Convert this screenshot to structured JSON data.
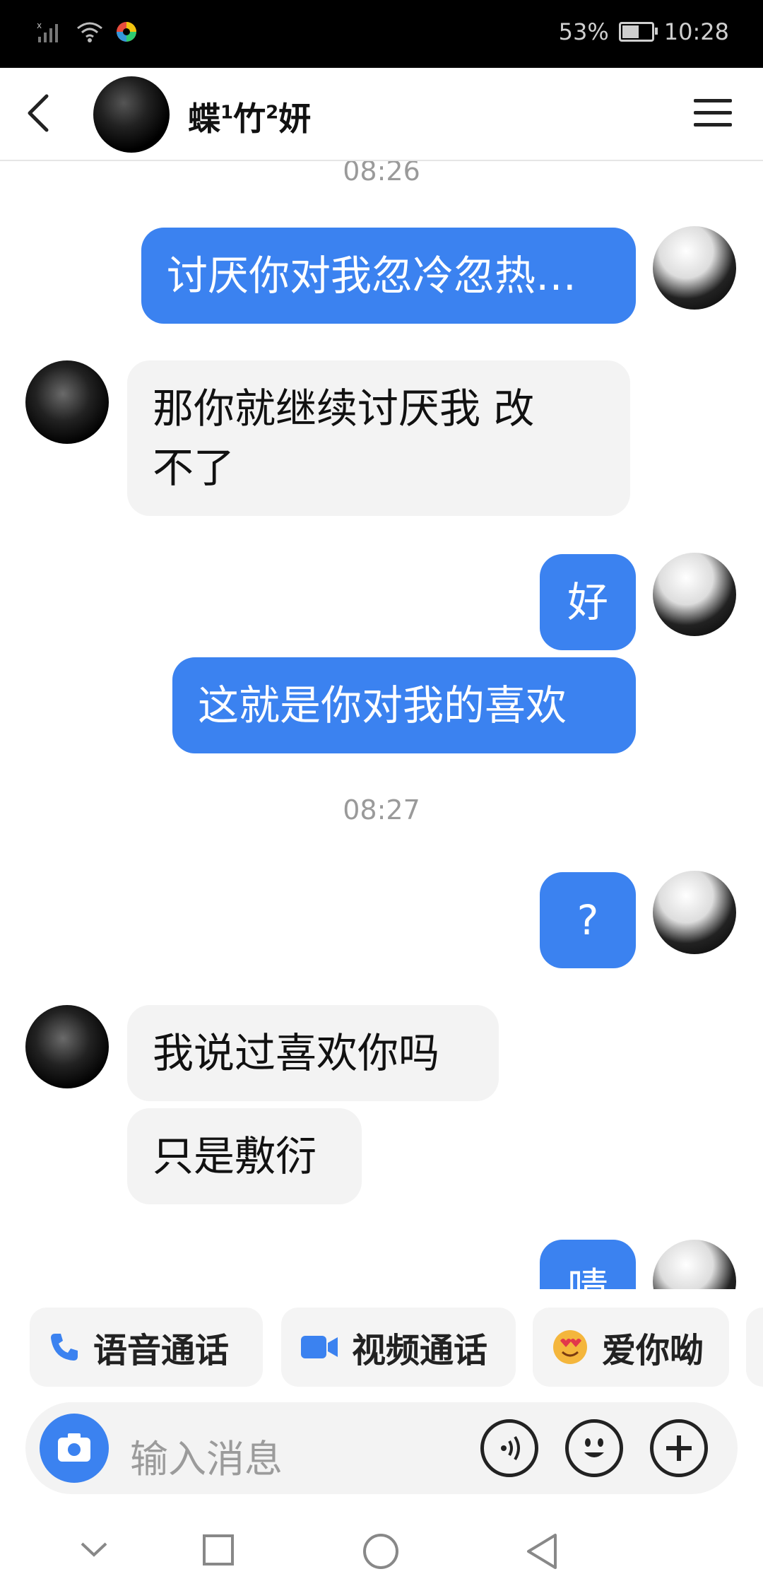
{
  "status_bar": {
    "battery_percent": "53%",
    "battery_level": 0.53,
    "time": "10:28"
  },
  "header": {
    "contact_name_part1": "蝶",
    "contact_name_sup1": "1",
    "contact_name_part2": "竹",
    "contact_name_sup2": "2",
    "contact_name_part3": "妍"
  },
  "messages": {
    "time_top": "08:26",
    "m1": "讨厌你对我忽冷忽热…",
    "m2_line1": "那你就继续讨厌我 改",
    "m2_line2": "不了",
    "m3": "好",
    "m4": "这就是你对我的喜欢",
    "time_mid": "08:27",
    "m5": "?",
    "m6": "我说过喜欢你吗",
    "m7": "只是敷衍",
    "m8_partial": "啧"
  },
  "quick_actions": {
    "voice_call": "语音通话",
    "video_call": "视频通话",
    "love_you": "爱你呦"
  },
  "input": {
    "placeholder": "输入消息"
  },
  "colors": {
    "outgoing_bubble": "#3b82f0",
    "incoming_bubble": "#f3f3f3",
    "accent": "#3b82f0"
  }
}
